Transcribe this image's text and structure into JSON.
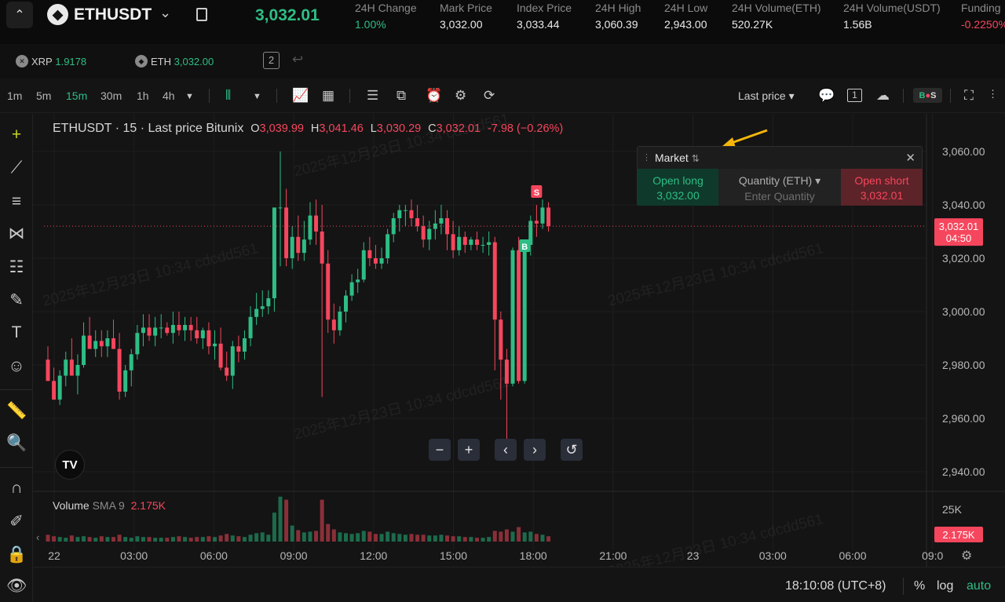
{
  "header": {
    "symbol": "ETHUSDT",
    "last_price": "3,032.01",
    "stats": [
      {
        "label": "24H Change",
        "value": "1.00%",
        "color": "green"
      },
      {
        "label": "Mark Price",
        "value": "3,032.00",
        "color": ""
      },
      {
        "label": "Index Price",
        "value": "3,033.44",
        "color": ""
      },
      {
        "label": "24H High",
        "value": "3,060.39",
        "color": ""
      },
      {
        "label": "24H Low",
        "value": "2,943.00",
        "color": ""
      },
      {
        "label": "24H Volume(ETH)",
        "value": "520.27K",
        "color": ""
      },
      {
        "label": "24H Volume(USDT)",
        "value": "1.56B",
        "color": ""
      },
      {
        "label": "Funding",
        "value": "-0.2250%",
        "color": "red"
      }
    ]
  },
  "favorites": [
    {
      "symbol": "XRP",
      "price": "1.9178"
    },
    {
      "symbol": "ETH",
      "price": "3,032.00"
    }
  ],
  "toolbar": {
    "timeframes": [
      "1m",
      "5m",
      "15m",
      "30m",
      "1h",
      "4h"
    ],
    "active_timeframe": "15m",
    "price_type": "Last price",
    "bs_label": "B S"
  },
  "legend": {
    "title": "ETHUSDT · 15 · Last price Bitunix",
    "o_label": "O",
    "o": "3,039.99",
    "h_label": "H",
    "h": "3,041.46",
    "l_label": "L",
    "l": "3,030.29",
    "c_label": "C",
    "c": "3,032.01",
    "change": "-7.98 (−0.26%)"
  },
  "volume": {
    "label": "Volume",
    "sma": "SMA 9",
    "value": "2.175K"
  },
  "market_panel": {
    "title": "Market",
    "open_long": "Open long",
    "long_price": "3,032.00",
    "quantity_label": "Quantity (ETH)",
    "quantity_placeholder": "Enter Quantity",
    "open_short": "Open short",
    "short_price": "3,032.01"
  },
  "price_axis": [
    "3,060.00",
    "3,040.00",
    "3,020.00",
    "3,000.00",
    "2,980.00",
    "2,960.00",
    "2,940.00"
  ],
  "price_tag": {
    "price": "3,032.01",
    "countdown": "04:50"
  },
  "volume_axis": {
    "top": "25K",
    "tag": "2.175K"
  },
  "time_axis": [
    "22",
    "03:00",
    "06:00",
    "09:00",
    "12:00",
    "15:00",
    "18:00",
    "21:00",
    "23",
    "03:00",
    "06:00",
    "09:0"
  ],
  "markers": {
    "sell": "S",
    "buy": "B"
  },
  "footer": {
    "clock": "18:10:08 (UTC+8)",
    "percent": "%",
    "log": "log",
    "auto": "auto"
  },
  "watermark": "2025年12月23日 10:34 cdcdd561",
  "colors": {
    "up": "#2ebd85",
    "down": "#f6465d",
    "accent": "#2ebd85"
  },
  "chart_data": {
    "type": "candlestick",
    "interval": "15m",
    "ylim": [
      2935,
      3070
    ],
    "last_price": 3032.01,
    "candles": [
      [
        2982.0,
        2987.0,
        2978.0,
        2974.0
      ],
      [
        2974.0,
        2979.0,
        2971.0,
        2967.0
      ],
      [
        2967.0,
        2978.0,
        2965.0,
        2976.0
      ],
      [
        2976.0,
        2985.0,
        2972.0,
        2982.0
      ],
      [
        2982.0,
        2990.0,
        2978.0,
        2976.0
      ],
      [
        2976.0,
        2984.0,
        2969.0,
        2980.0
      ],
      [
        2980.0,
        2996.0,
        2979.0,
        2991.0
      ],
      [
        2991.0,
        2998.0,
        2987.0,
        2986.0
      ],
      [
        2986.0,
        2993.0,
        2983.0,
        2989.0
      ],
      [
        2989.0,
        2993.0,
        2983.0,
        2987.0
      ],
      [
        2987.0,
        2993.0,
        2983.0,
        2990.0
      ],
      [
        2990.0,
        2997.0,
        2986.0,
        2986.0
      ],
      [
        2986.0,
        2992.0,
        2967.0,
        2970.0
      ],
      [
        2970.0,
        2980.0,
        2968.0,
        2978.0
      ],
      [
        2978.0,
        2986.0,
        2972.0,
        2984.0
      ],
      [
        2984.0,
        2995.0,
        2982.0,
        2992.0
      ],
      [
        2992.0,
        2999.0,
        2987.0,
        2994.0
      ],
      [
        2994.0,
        2999.0,
        2989.0,
        2991.0
      ],
      [
        2991.0,
        2998.0,
        2987.0,
        2994.0
      ],
      [
        2994.0,
        2999.0,
        2990.0,
        2994.0
      ],
      [
        2994.0,
        2996.0,
        2991.0,
        2992.0
      ],
      [
        2992.0,
        3000.0,
        2988.0,
        2995.0
      ],
      [
        2995.0,
        3000.0,
        2991.0,
        2993.0
      ],
      [
        2993.0,
        2998.0,
        2989.0,
        2995.0
      ],
      [
        2995.0,
        2998.0,
        2989.0,
        2993.0
      ],
      [
        2993.0,
        2998.0,
        2988.0,
        2990.0
      ],
      [
        2990.0,
        2994.0,
        2986.0,
        2993.0
      ],
      [
        2993.0,
        2996.0,
        2984.0,
        2987.0
      ],
      [
        2987.0,
        2993.0,
        2982.0,
        2988.0
      ],
      [
        2988.0,
        2994.0,
        2978.0,
        2979.0
      ],
      [
        2979.0,
        2985.0,
        2974.0,
        2976.0
      ],
      [
        2976.0,
        2989.0,
        2971.0,
        2987.0
      ],
      [
        2987.0,
        2991.0,
        2981.0,
        2985.0
      ],
      [
        2985.0,
        2993.0,
        2982.0,
        2990.0
      ],
      [
        2990.0,
        3002.0,
        2987.0,
        2998.0
      ],
      [
        2998.0,
        3007.0,
        2995.0,
        3001.0
      ],
      [
        3001.0,
        3008.0,
        2998.0,
        3002.0
      ],
      [
        3002.0,
        3008.0,
        2999.0,
        3005.0
      ],
      [
        3005.0,
        3011.0,
        3000.0,
        3039.0
      ],
      [
        3039.0,
        3060.0,
        3017.0,
        3039.0
      ],
      [
        3039.0,
        3046.0,
        3017.0,
        3020.0
      ],
      [
        3020.0,
        3032.0,
        3016.0,
        3028.0
      ],
      [
        3028.0,
        3036.0,
        3019.0,
        3022.0
      ],
      [
        3022.0,
        3034.0,
        3019.0,
        3027.0
      ],
      [
        3027.0,
        3041.0,
        3025.0,
        3036.0
      ],
      [
        3036.0,
        3042.0,
        3025.0,
        3030.0
      ],
      [
        3030.0,
        3040.0,
        2968.0,
        3018.0
      ],
      [
        3018.0,
        3023.0,
        2992.0,
        2997.0
      ],
      [
        2997.0,
        3003.0,
        2988.0,
        2993.0
      ],
      [
        2993.0,
        3002.0,
        2991.0,
        3000.0
      ],
      [
        3000.0,
        3008.0,
        2996.0,
        3006.0
      ],
      [
        3006.0,
        3014.0,
        3004.0,
        3011.0
      ],
      [
        3011.0,
        3016.0,
        3007.0,
        3012.0
      ],
      [
        3012.0,
        3026.0,
        3011.0,
        3023.0
      ],
      [
        3023.0,
        3028.0,
        3017.0,
        3020.0
      ],
      [
        3020.0,
        3025.0,
        3016.0,
        3018.0
      ],
      [
        3018.0,
        3024.0,
        3016.0,
        3020.0
      ],
      [
        3020.0,
        3031.0,
        3018.0,
        3029.0
      ],
      [
        3029.0,
        3037.0,
        3026.0,
        3035.0
      ],
      [
        3035.0,
        3040.0,
        3030.0,
        3038.0
      ],
      [
        3038.0,
        3040.0,
        3032.0,
        3038.0
      ],
      [
        3038.0,
        3042.0,
        3032.0,
        3035.0
      ],
      [
        3035.0,
        3040.0,
        3030.0,
        3032.0
      ],
      [
        3032.0,
        3036.0,
        3024.0,
        3027.0
      ],
      [
        3027.0,
        3034.0,
        3023.0,
        3031.0
      ],
      [
        3031.0,
        3038.0,
        3027.0,
        3033.0
      ],
      [
        3033.0,
        3040.0,
        3029.0,
        3035.0
      ],
      [
        3035.0,
        3038.0,
        3023.0,
        3029.0
      ],
      [
        3029.0,
        3034.0,
        3020.0,
        3023.0
      ],
      [
        3023.0,
        3032.0,
        3021.0,
        3028.0
      ],
      [
        3028.0,
        3030.0,
        3022.0,
        3025.0
      ],
      [
        3025.0,
        3028.0,
        3023.0,
        3027.0
      ],
      [
        3027.0,
        3030.0,
        3023.0,
        3025.0
      ],
      [
        3025.0,
        3028.0,
        3022.0,
        3025.0
      ],
      [
        3025.0,
        3030.0,
        3021.0,
        3026.0
      ],
      [
        3026.0,
        3028.0,
        2978.0,
        2997.0
      ],
      [
        2997.0,
        3000.0,
        2967.0,
        2982.0
      ],
      [
        2982.0,
        2986.0,
        2952.0,
        2973.0
      ],
      [
        2973.0,
        3024.0,
        2972.0,
        3023.0
      ],
      [
        3023.0,
        3028.0,
        2973.0,
        2974.0
      ],
      [
        2974.0,
        3026.0,
        2973.0,
        3025.0
      ],
      [
        3025.0,
        3036.0,
        3021.0,
        3034.0
      ],
      [
        3034.0,
        3040.0,
        3028.0,
        3033.0
      ],
      [
        3033.0,
        3042.0,
        3031.0,
        3039.0
      ],
      [
        3039.0,
        3041.0,
        3030.0,
        3032.0
      ]
    ],
    "volumes": [
      0.9,
      0.7,
      0.6,
      0.5,
      0.8,
      0.6,
      0.7,
      0.6,
      0.5,
      0.7,
      0.6,
      0.6,
      0.9,
      0.6,
      0.5,
      0.7,
      0.6,
      0.6,
      0.5,
      0.5,
      0.5,
      0.6,
      0.7,
      0.6,
      0.5,
      0.6,
      0.6,
      0.7,
      0.6,
      0.8,
      1.0,
      0.8,
      0.7,
      0.6,
      0.9,
      1.1,
      1.2,
      0.9,
      3.8,
      5.9,
      5.5,
      2.1,
      1.5,
      1.2,
      1.3,
      1.4,
      5.5,
      2.3,
      1.6,
      1.2,
      1.1,
      1.0,
      1.1,
      1.4,
      1.3,
      1.0,
      1.0,
      1.3,
      1.1,
      1.0,
      0.9,
      1.0,
      0.9,
      0.9,
      0.8,
      0.8,
      0.9,
      0.8,
      0.7,
      0.7,
      0.6,
      0.6,
      0.5,
      0.5,
      0.6,
      1.4,
      1.3,
      1.6,
      1.3,
      1.9,
      1.2,
      1.3,
      1.0,
      0.9,
      0.7
    ],
    "sell_marker_index": 82,
    "buy_marker_index": 80
  }
}
